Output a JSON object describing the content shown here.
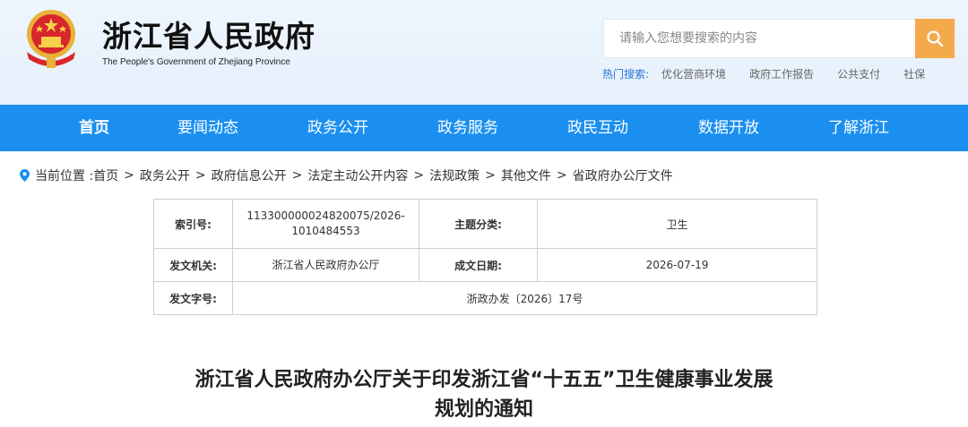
{
  "header": {
    "site_title": "浙江省人民政府",
    "site_subtitle": "The People's Government of Zhejiang Province",
    "emblem_icon": "national-emblem-icon"
  },
  "search": {
    "placeholder": "请输入您想要搜索的内容",
    "value": "",
    "button_icon": "search-icon",
    "button_color": "#f4aa4b"
  },
  "hot_search": {
    "label": "热门搜索:",
    "items": [
      "优化营商环境",
      "政府工作报告",
      "公共支付",
      "社保"
    ]
  },
  "nav": {
    "color": "#1a8ff0",
    "items": [
      {
        "label": "首页",
        "active": true
      },
      {
        "label": "要闻动态"
      },
      {
        "label": "政务公开"
      },
      {
        "label": "政务服务"
      },
      {
        "label": "政民互动"
      },
      {
        "label": "数据开放"
      },
      {
        "label": "了解浙江"
      }
    ]
  },
  "breadcrumb": {
    "prefix": "当前位置 :",
    "icon": "location-pin-icon",
    "items": [
      "首页",
      "政务公开",
      "政府信息公开",
      "法定主动公开内容",
      "法规政策",
      "其他文件",
      "省政府办公厅文件"
    ],
    "separator": ">"
  },
  "meta": {
    "index_label": "索引号:",
    "index_value": "113300000024820075/2026-1010484553",
    "topic_label": "主题分类:",
    "topic_value": "卫生",
    "issuer_label": "发文机关:",
    "issuer_value": "浙江省人民政府办公厅",
    "date_label": "成文日期:",
    "date_value": "2026-07-19",
    "docno_label": "发文字号:",
    "docno_value": "浙政办发〔2026〕17号"
  },
  "document": {
    "title_line1": "浙江省人民政府办公厅关于印发浙江省“十五五”卫生健康事业发展",
    "title_line2": "规划的通知"
  }
}
